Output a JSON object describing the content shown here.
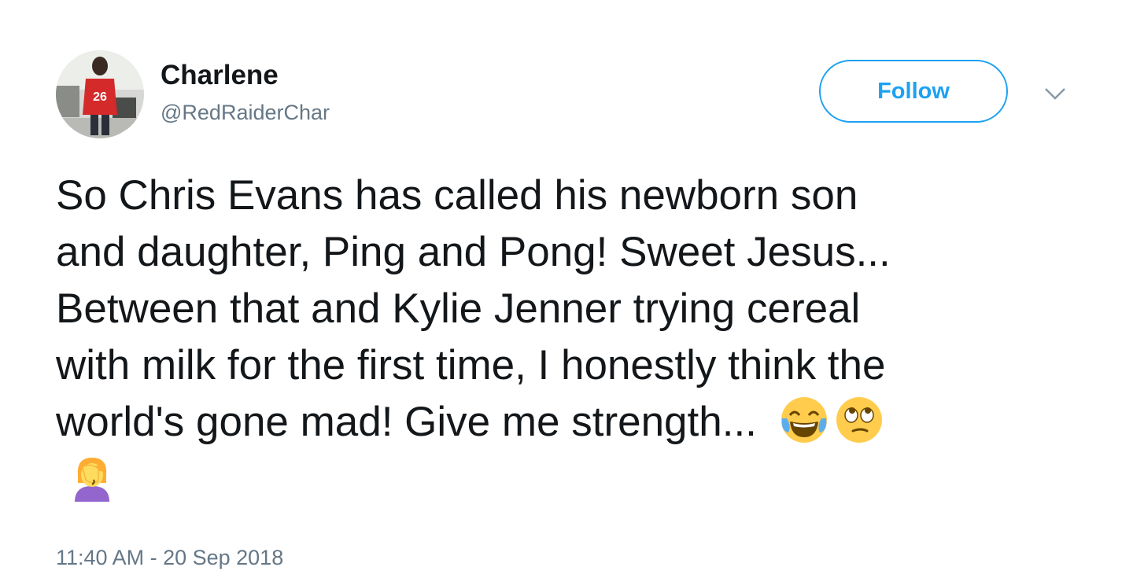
{
  "author": {
    "display_name": "Charlene",
    "handle": "@RedRaiderChar",
    "avatar_jersey_number": "26"
  },
  "follow_button": {
    "label": "Follow"
  },
  "menu": {
    "icon": "chevron-down-icon"
  },
  "tweet": {
    "lines": [
      "So Chris Evans has called his newborn son",
      "and daughter, Ping and Pong! Sweet Jesus...",
      "Between that and Kylie Jenner trying cereal",
      "with milk for the first time, I honestly think the",
      "world's gone mad! Give me strength..."
    ],
    "emojis": [
      "face-with-tears-of-joy",
      "face-with-rolling-eyes",
      "woman-facepalming"
    ]
  },
  "timestamp": "11:40 AM - 20 Sep 2018",
  "colors": {
    "accent": "#1da1f2",
    "secondary_text": "#657786",
    "primary_text": "#14171a"
  }
}
